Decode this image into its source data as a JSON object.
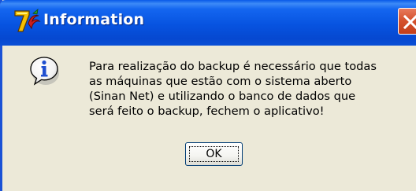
{
  "window": {
    "title": "Information",
    "title_icon": "tabwin-7-logo-icon",
    "close_icon": "close-icon"
  },
  "dialog": {
    "icon": "info-icon",
    "message_lines": [
      "Para realização do backup é necessário que todas",
      "as máquinas que estão com o sistema aberto",
      "(Sinan Net) e utilizando o banco de dados que",
      "será feito o backup, fechem o aplicativo!"
    ],
    "ok_label": "OK"
  },
  "colors": {
    "titlebar": "#0753e0",
    "dialog_background": "#ece9d8",
    "close_button": "#d5532f",
    "info_icon_blue": "#1f4fd0"
  }
}
